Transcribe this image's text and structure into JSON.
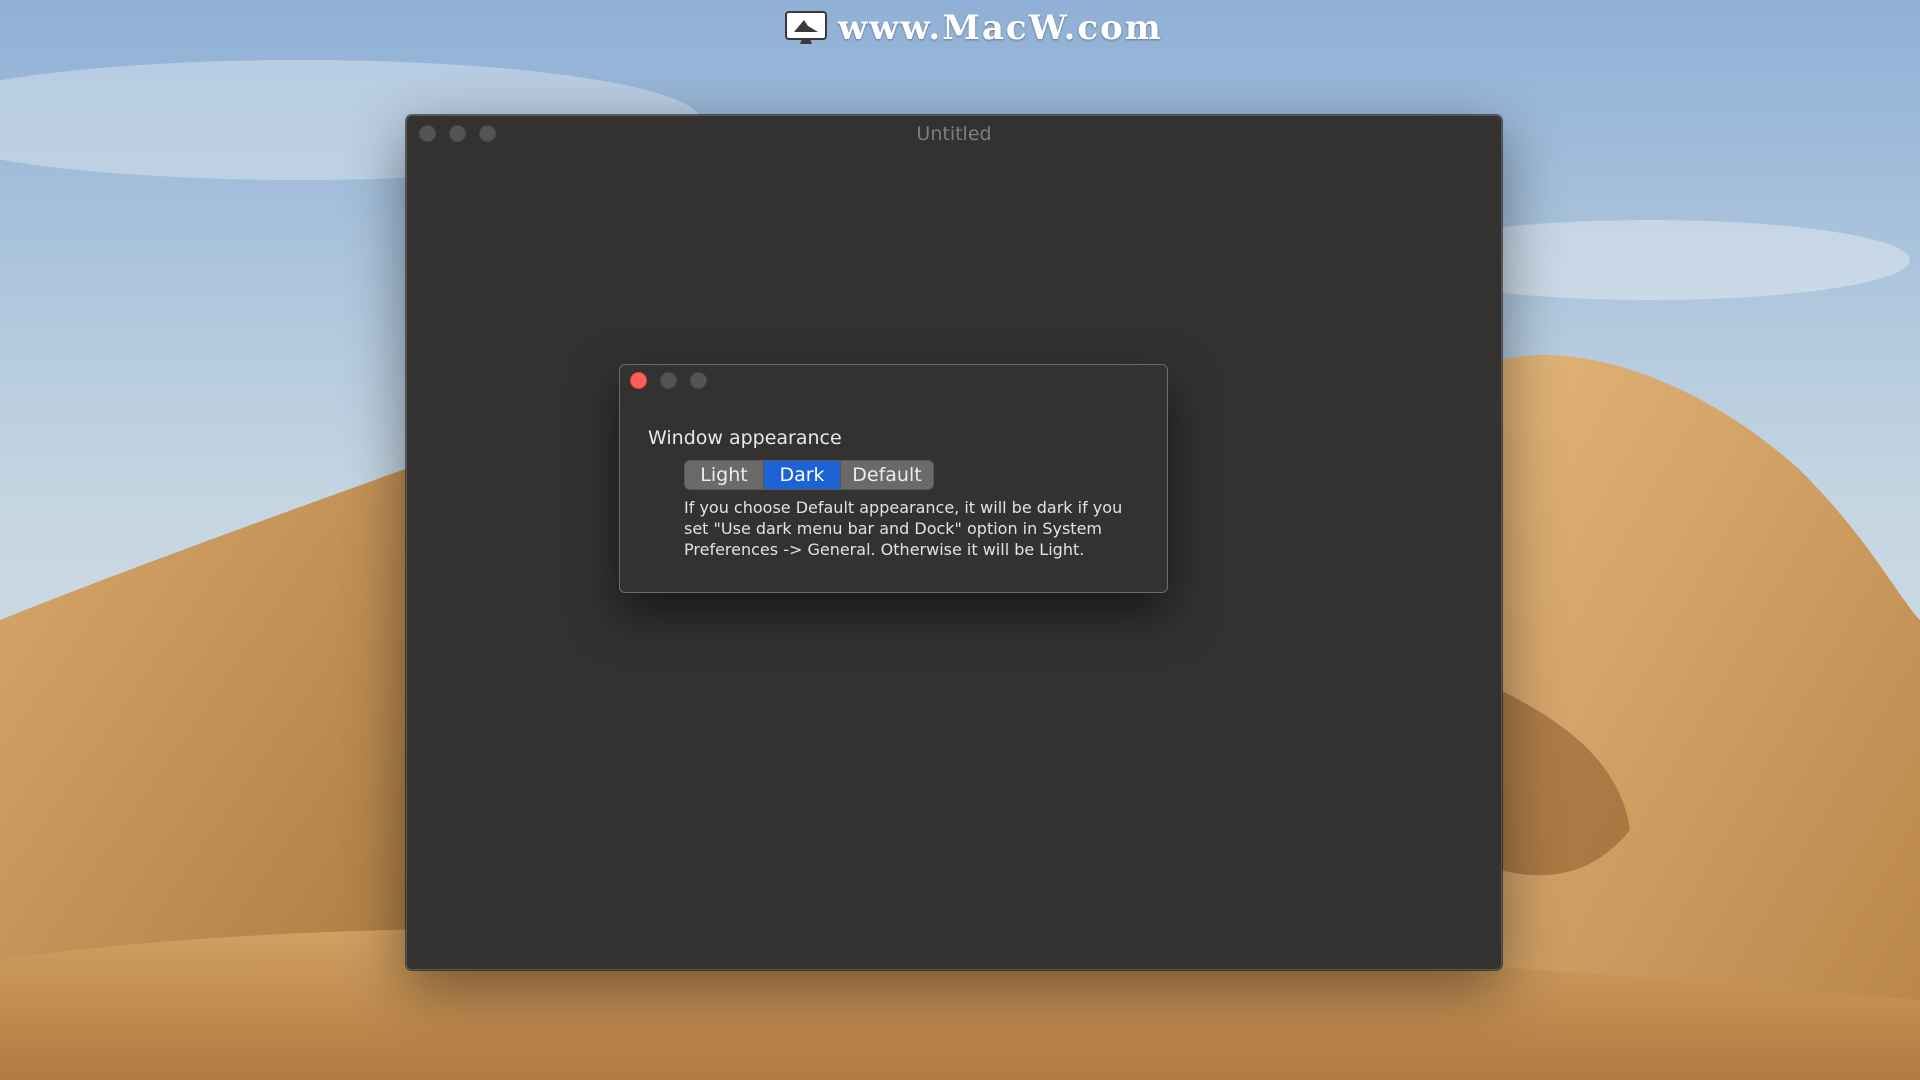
{
  "watermark": {
    "text": "www.MacW.com",
    "logo_icon": "monitor-logo-icon"
  },
  "main_window": {
    "title": "Untitled",
    "traffic_lights": [
      "close-button",
      "minimize-button",
      "zoom-button"
    ]
  },
  "appearance_panel": {
    "heading": "Window appearance",
    "segments": [
      "Light",
      "Dark",
      "Default"
    ],
    "selected": "Dark",
    "description": "If you choose Default appearance, it will be dark if you set \"Use dark menu bar and Dock\" option in System Preferences -> General. Otherwise it will be Light."
  },
  "colors": {
    "window_bg": "#333231",
    "accent": "#1b63d6",
    "close_red": "#fd5e57"
  }
}
